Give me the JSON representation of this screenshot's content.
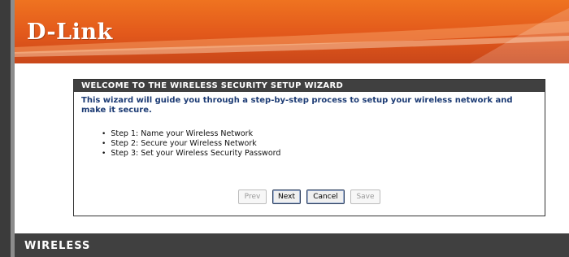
{
  "brand": {
    "logo_text": "D-Link"
  },
  "wizard": {
    "title": "WELCOME TO THE WIRELESS SECURITY SETUP WIZARD",
    "intro": "This wizard will guide you through a step-by-step process to setup your wireless network and make it secure.",
    "steps": [
      "Step 1: Name your Wireless Network",
      "Step 2: Secure your Wireless Network",
      "Step 3: Set your Wireless Security Password"
    ],
    "buttons": {
      "prev": "Prev",
      "next": "Next",
      "cancel": "Cancel",
      "save": "Save"
    }
  },
  "footer": {
    "label": "WIRELESS"
  },
  "colors": {
    "header_orange": "#e2581b",
    "title_bar": "#404040",
    "intro_text": "#1c3b74"
  }
}
